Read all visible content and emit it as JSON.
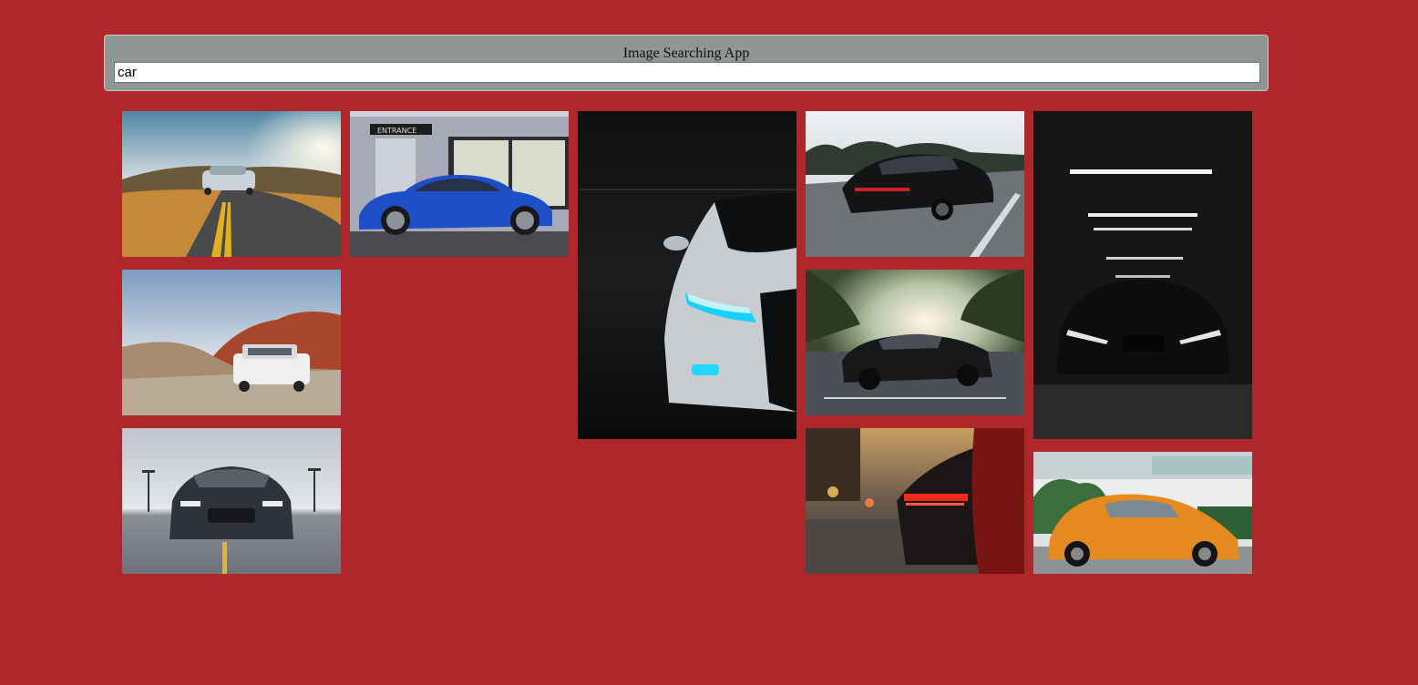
{
  "app": {
    "title": "Image Searching App"
  },
  "search": {
    "value": "car"
  },
  "results": [
    {
      "icon": "gtr-road-sunset-photo"
    },
    {
      "icon": "blue-coupe-entrance-photo"
    },
    {
      "icon": "dark-audi-headlight-photo"
    },
    {
      "icon": "black-porsche-highway-photo"
    },
    {
      "icon": "white-suv-desert-photo"
    },
    {
      "icon": "black-mustang-sunset-photo"
    },
    {
      "icon": "black-audi-garage-photo"
    },
    {
      "icon": "gray-mustang-front-photo"
    },
    {
      "icon": "red-taillights-street-photo"
    },
    {
      "icon": "orange-beetle-photo"
    }
  ],
  "colors": {
    "page_background": "#ad272b",
    "panel_background": "#8f9693"
  }
}
